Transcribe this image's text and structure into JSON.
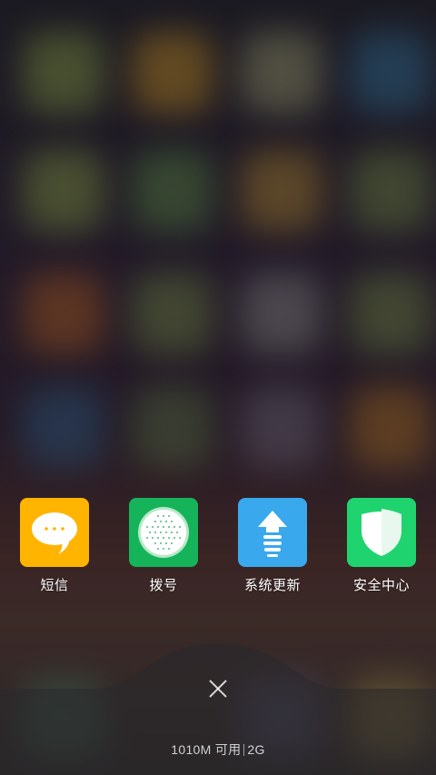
{
  "recent_apps": [
    {
      "id": "sms",
      "label": "短信",
      "icon": "message-bubble-icon",
      "color": "#FFB400"
    },
    {
      "id": "dialer",
      "label": "拨号",
      "icon": "dialpad-icon",
      "color": "#15B45A"
    },
    {
      "id": "updater",
      "label": "系统更新",
      "icon": "upload-arrow-icon",
      "color": "#3AA8EC"
    },
    {
      "id": "security",
      "label": "安全中心",
      "icon": "shield-icon",
      "color": "#1FD46E"
    }
  ],
  "close": {
    "icon": "close-icon"
  },
  "memory": {
    "available": "1010M 可用",
    "network": "2G"
  }
}
